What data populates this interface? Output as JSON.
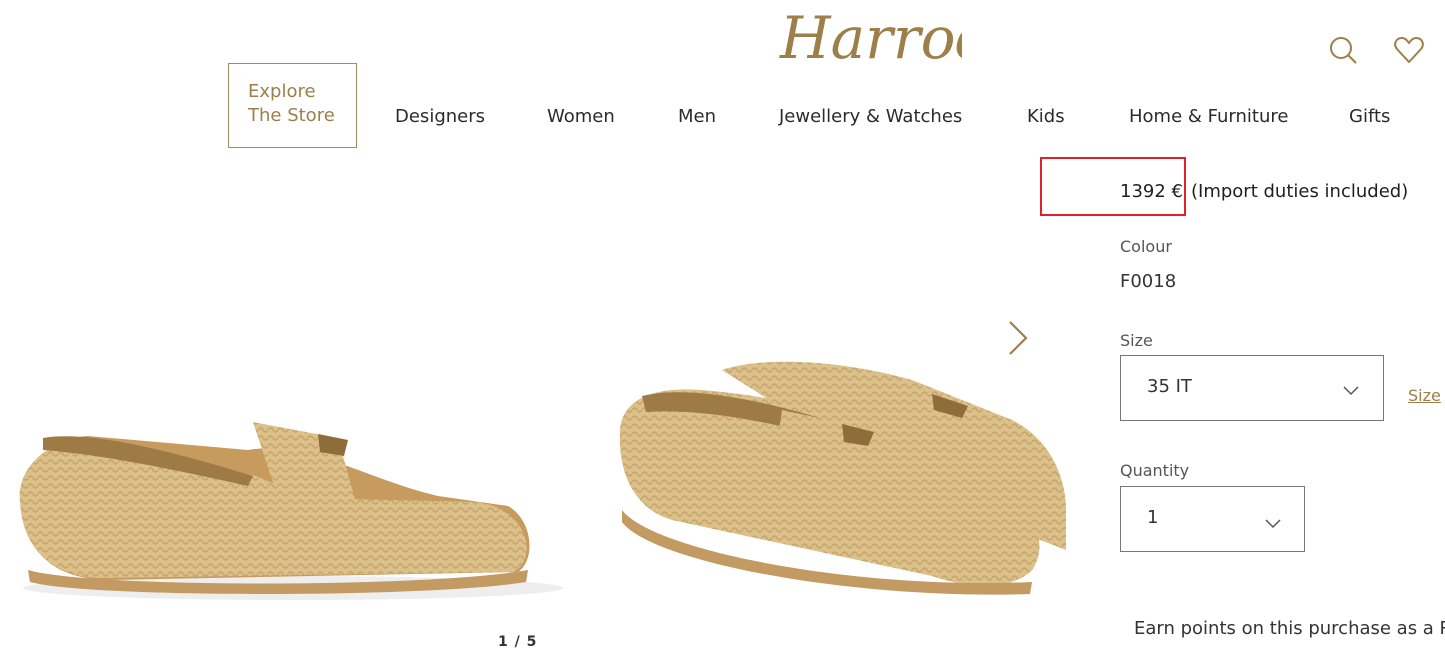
{
  "brand": {
    "logo_text": "Harrods",
    "accent_color": "#9c7f49"
  },
  "header": {
    "search_icon": "search-icon",
    "wishlist_icon": "heart-icon",
    "explore": {
      "line1": "Explore",
      "line2": "The Store"
    },
    "nav": [
      {
        "label": "Designers"
      },
      {
        "label": "Women"
      },
      {
        "label": "Men"
      },
      {
        "label": "Jewellery & Watches"
      },
      {
        "label": "Kids"
      },
      {
        "label": "Home & Furniture"
      },
      {
        "label": "Gifts"
      }
    ]
  },
  "gallery": {
    "pager": "1 / 5",
    "next_icon": "chevron-right-icon"
  },
  "product": {
    "price": "1392 €",
    "price_note": "(Import duties included)",
    "highlight_color": "#e0202a",
    "colour_label": "Colour",
    "colour_value": "F0018",
    "size_label": "Size",
    "size_value": "35 IT",
    "size_guide": "Size",
    "quantity_label": "Quantity",
    "quantity_value": "1",
    "rewards_text": "Earn points on this purchase as a Rewa"
  }
}
